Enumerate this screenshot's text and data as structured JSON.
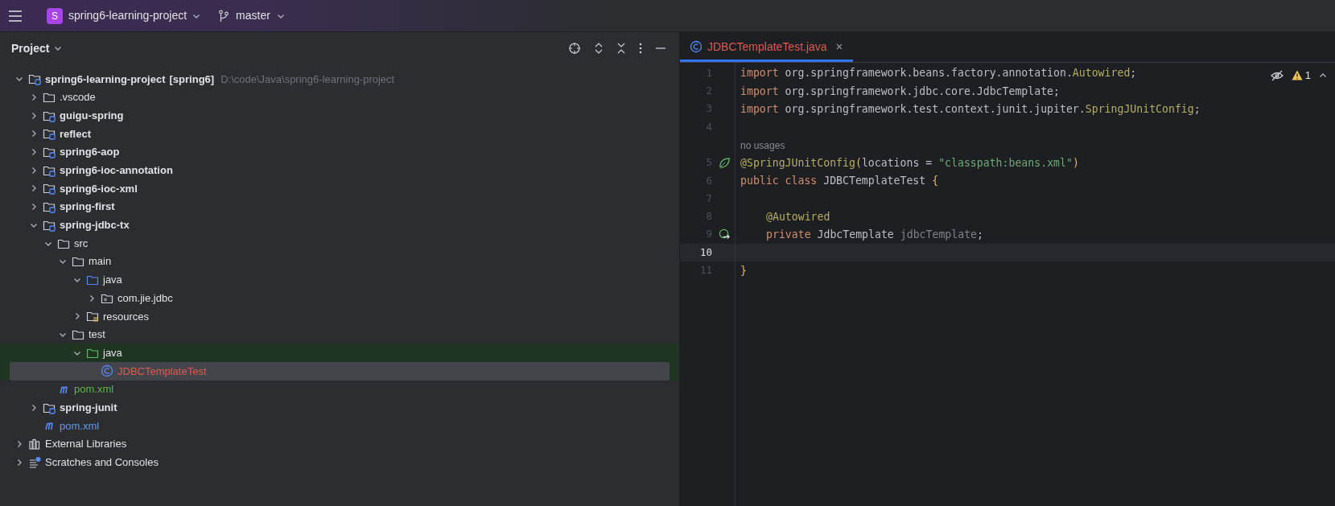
{
  "top_bar": {
    "project": {
      "initial": "S",
      "name": "spring6-learning-project"
    },
    "branch": "master"
  },
  "project_panel": {
    "title": "Project",
    "tree": [
      {
        "kind": "module",
        "name": "spring6-learning-project",
        "tag": "[spring6]",
        "path": "D:\\code\\Java\\spring6-learning-project",
        "expanded": true,
        "selected": false,
        "children": [
          {
            "kind": "folder",
            "name": ".vscode",
            "expanded": false,
            "selected": false
          },
          {
            "kind": "module",
            "name": "guigu-spring",
            "expanded": false,
            "selected": false
          },
          {
            "kind": "module",
            "name": "reflect",
            "expanded": false,
            "selected": false
          },
          {
            "kind": "module",
            "name": "spring6-aop",
            "expanded": false,
            "selected": false
          },
          {
            "kind": "module",
            "name": "spring6-ioc-annotation",
            "expanded": false,
            "selected": false
          },
          {
            "kind": "module",
            "name": "spring6-ioc-xml",
            "expanded": false,
            "selected": false
          },
          {
            "kind": "module",
            "name": "spring-first",
            "expanded": false,
            "selected": false
          },
          {
            "kind": "module",
            "name": "spring-jdbc-tx",
            "expanded": true,
            "selected": false,
            "children": [
              {
                "kind": "folder",
                "name": "src",
                "expanded": true,
                "selected": false,
                "children": [
                  {
                    "kind": "folder",
                    "name": "main",
                    "expanded": true,
                    "selected": false,
                    "children": [
                      {
                        "kind": "source-folder",
                        "name": "java",
                        "expanded": true,
                        "selected": false,
                        "children": [
                          {
                            "kind": "package",
                            "name": "com.jie.jdbc",
                            "expanded": false,
                            "selected": false
                          }
                        ]
                      },
                      {
                        "kind": "resources-folder",
                        "name": "resources",
                        "expanded": false,
                        "selected": false
                      }
                    ]
                  },
                  {
                    "kind": "folder",
                    "name": "test",
                    "expanded": true,
                    "selected": false,
                    "children": [
                      {
                        "kind": "test-folder",
                        "name": "java",
                        "expanded": true,
                        "selected": false,
                        "highlighted": true,
                        "children": [
                          {
                            "kind": "class",
                            "name": "JDBCTemplateTest",
                            "selected": true,
                            "color": "#e05a4f"
                          }
                        ]
                      }
                    ]
                  }
                ]
              },
              {
                "kind": "maven",
                "name": "pom.xml",
                "selected": false,
                "color": "#62b543"
              }
            ]
          },
          {
            "kind": "module",
            "name": "spring-junit",
            "expanded": false,
            "selected": false
          },
          {
            "kind": "maven",
            "name": "pom.xml",
            "selected": false,
            "color": "#5c9ded"
          }
        ]
      },
      {
        "kind": "libraries",
        "name": "External Libraries",
        "expanded": false,
        "selected": false
      },
      {
        "kind": "scratches",
        "name": "Scratches and Consoles",
        "expanded": false,
        "selected": false
      }
    ]
  },
  "editor": {
    "tabs": [
      {
        "label": "JDBCTemplateTest.java",
        "selected": true,
        "color": "#e05a4f"
      }
    ],
    "warnings": "1",
    "lines": [
      {
        "kind": "code",
        "number": "1",
        "current": false,
        "tokens": [
          {
            "text": "import ",
            "kind": "keyword"
          },
          {
            "text": "org.springframework.beans.factory.annotation.",
            "kind": "plain"
          },
          {
            "text": "Autowired",
            "kind": "annotation"
          },
          {
            "text": ";",
            "kind": "plain"
          }
        ]
      },
      {
        "kind": "code",
        "number": "2",
        "current": false,
        "tokens": [
          {
            "text": "import ",
            "kind": "keyword"
          },
          {
            "text": "org.springframework.jdbc.core.JdbcTemplate;",
            "kind": "plain"
          }
        ]
      },
      {
        "kind": "code",
        "number": "3",
        "current": false,
        "tokens": [
          {
            "text": "import ",
            "kind": "keyword"
          },
          {
            "text": "org.springframework.test.context.junit.jupiter.",
            "kind": "plain"
          },
          {
            "text": "SpringJUnitConfig",
            "kind": "annotation"
          },
          {
            "text": ";",
            "kind": "plain"
          }
        ]
      },
      {
        "kind": "code",
        "number": "4",
        "current": false
      },
      {
        "kind": "inlay",
        "text": "no usages"
      },
      {
        "kind": "code",
        "number": "5",
        "current": false,
        "gutter": {
          "kind": "spring"
        },
        "tokens": [
          {
            "text": "@SpringJUnitConfig",
            "kind": "annotation"
          },
          {
            "text": "(",
            "kind": "brace"
          },
          {
            "text": "locations = ",
            "kind": "plain"
          },
          {
            "text": "\"classpath:beans.xml\"",
            "kind": "string"
          },
          {
            "text": ")",
            "kind": "brace"
          }
        ]
      },
      {
        "kind": "code",
        "number": "6",
        "current": false,
        "tokens": [
          {
            "text": "public class ",
            "kind": "keyword"
          },
          {
            "text": "JDBCTemplateTest ",
            "kind": "plain"
          },
          {
            "text": "{",
            "kind": "brace"
          }
        ]
      },
      {
        "kind": "code",
        "number": "7",
        "current": false
      },
      {
        "kind": "code",
        "number": "8",
        "current": false,
        "indented": true,
        "tokens": [
          {
            "text": "@Autowired",
            "kind": "annotation"
          }
        ]
      },
      {
        "kind": "code",
        "number": "9",
        "current": false,
        "indented": true,
        "gutter": {
          "kind": "bean"
        },
        "tokens": [
          {
            "text": "private ",
            "kind": "keyword"
          },
          {
            "text": "JdbcTemplate ",
            "kind": "plain"
          },
          {
            "text": "jdbcTemplate",
            "kind": "unused"
          },
          {
            "text": ";",
            "kind": "plain"
          }
        ]
      },
      {
        "kind": "code",
        "number": "10",
        "current": true
      },
      {
        "kind": "code",
        "number": "11",
        "current": false,
        "tokens": [
          {
            "text": "}",
            "kind": "brace"
          }
        ]
      }
    ]
  }
}
